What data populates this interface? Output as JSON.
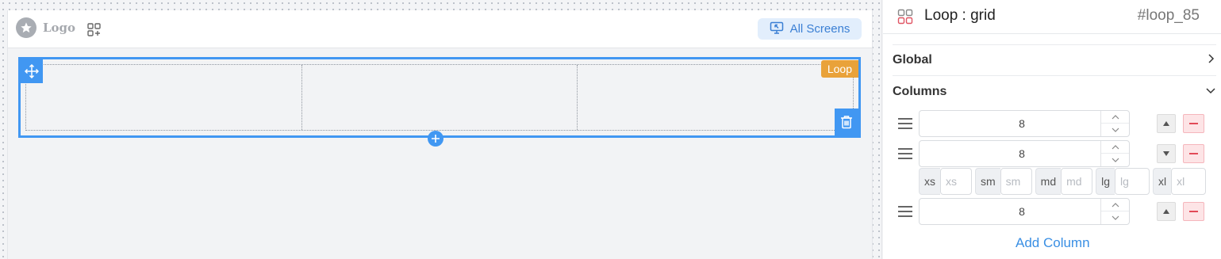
{
  "canvas": {
    "logo_text": "Logo",
    "all_screens_label": "All Screens",
    "loop_tag": "Loop",
    "columns_count": 3
  },
  "panel": {
    "title": "Loop : grid",
    "id": "#loop_85",
    "sections": {
      "global": "Global",
      "columns": "Columns"
    },
    "columns": [
      {
        "value": "8"
      },
      {
        "value": "8"
      },
      {
        "value": "8"
      }
    ],
    "breakpoints": [
      {
        "label": "xs",
        "placeholder": "xs"
      },
      {
        "label": "sm",
        "placeholder": "sm"
      },
      {
        "label": "md",
        "placeholder": "md"
      },
      {
        "label": "lg",
        "placeholder": "lg"
      },
      {
        "label": "xl",
        "placeholder": "xl"
      }
    ],
    "add_column_label": "Add Column"
  },
  "colors": {
    "accent": "#4197f2",
    "loop_tag": "#e9a23a",
    "link": "#3a8fe4",
    "danger": "#e24a57"
  },
  "icons": [
    "star-icon",
    "apps-add-icon",
    "screen-icon",
    "move-icon",
    "trash-icon",
    "plus-icon",
    "grid-icon",
    "chevron-right-icon",
    "chevron-down-icon",
    "drag-handle-icon",
    "chevron-up-icon",
    "arrow-up-icon",
    "arrow-down-icon",
    "minus-icon"
  ]
}
